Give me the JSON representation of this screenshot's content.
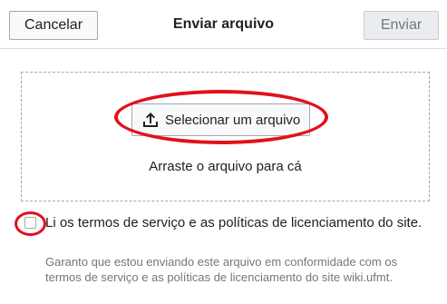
{
  "header": {
    "cancel_label": "Cancelar",
    "title": "Enviar arquivo",
    "send_label": "Enviar"
  },
  "upload": {
    "select_label": "Selecionar um arquivo",
    "select_icon": "upload-icon",
    "drop_hint": "Arraste o arquivo para cá"
  },
  "terms": {
    "checked": false,
    "label": "Li os termos de serviço e as políticas de licenciamento do site.",
    "help": "Garanto que estou enviando este arquivo em conformidade com os termos de serviço e as políticas de licenciamento do site wiki.ufmt."
  },
  "annotations": {
    "highlight_color": "#e2101b"
  }
}
